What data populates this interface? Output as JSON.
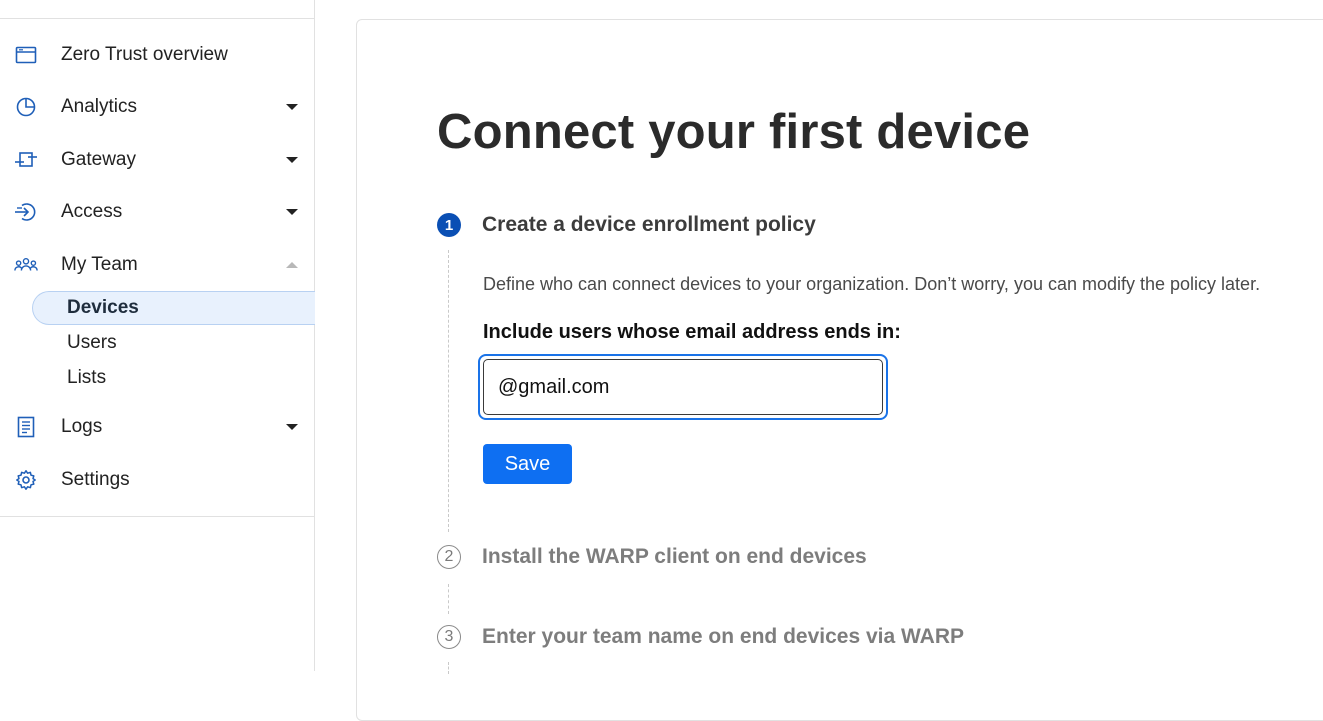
{
  "sidebar": {
    "items": [
      {
        "label": "Zero Trust overview",
        "icon": "browser-window-icon"
      },
      {
        "label": "Analytics",
        "icon": "pie-chart-icon",
        "caret": "down"
      },
      {
        "label": "Gateway",
        "icon": "gateway-icon",
        "caret": "down"
      },
      {
        "label": "Access",
        "icon": "access-arrow-icon",
        "caret": "down"
      },
      {
        "label": "My Team",
        "icon": "team-icon",
        "caret": "up"
      },
      {
        "label": "Logs",
        "icon": "log-list-icon",
        "caret": "down"
      },
      {
        "label": "Settings",
        "icon": "gear-icon"
      }
    ],
    "my_team_sub": [
      {
        "label": "Devices",
        "active": true
      },
      {
        "label": "Users"
      },
      {
        "label": "Lists"
      }
    ]
  },
  "main": {
    "title": "Connect your first device",
    "steps": [
      {
        "number": "1",
        "title": "Create a device enrollment policy",
        "state": "active"
      },
      {
        "number": "2",
        "title": "Install the WARP client on end devices",
        "state": "inactive"
      },
      {
        "number": "3",
        "title": "Enter your team name on end devices via WARP",
        "state": "inactive"
      }
    ],
    "step1": {
      "description": "Define who can connect devices to your organization. Don’t worry, you can modify the policy later.",
      "field_label": "Include users whose email address ends in:",
      "email_value": "@gmail.com",
      "save_label": "Save"
    }
  },
  "colors": {
    "accent": "#0e6ff2",
    "step_active": "#0a4fb4",
    "active_nav_bg": "#e8f1fd",
    "icon_blue": "#1f5fb8"
  }
}
